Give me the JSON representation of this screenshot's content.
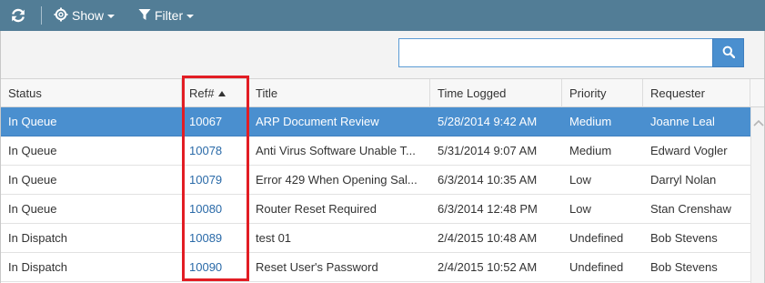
{
  "toolbar": {
    "show_label": "Show",
    "filter_label": "Filter"
  },
  "search": {
    "placeholder": "",
    "value": ""
  },
  "columns": {
    "status": "Status",
    "ref": "Ref#",
    "title": "Title",
    "time_logged": "Time Logged",
    "priority": "Priority",
    "requester": "Requester"
  },
  "sort": {
    "column": "ref",
    "direction": "ascending"
  },
  "rows": [
    {
      "status": "In Queue",
      "ref": "10067",
      "title": "ARP Document Review",
      "time_logged": "5/28/2014 9:42 AM",
      "priority": "Medium",
      "requester": "Joanne Leal",
      "selected": true
    },
    {
      "status": "In Queue",
      "ref": "10078",
      "title": "Anti Virus Software Unable T...",
      "time_logged": "5/31/2014 9:07 AM",
      "priority": "Medium",
      "requester": "Edward Vogler",
      "selected": false
    },
    {
      "status": "In Queue",
      "ref": "10079",
      "title": "Error 429 When Opening Sal...",
      "time_logged": "6/3/2014 10:35 AM",
      "priority": "Low",
      "requester": "Darryl Nolan",
      "selected": false
    },
    {
      "status": "In Queue",
      "ref": "10080",
      "title": "Router Reset Required",
      "time_logged": "6/3/2014 12:48 PM",
      "priority": "Low",
      "requester": "Stan Crenshaw",
      "selected": false
    },
    {
      "status": "In Dispatch",
      "ref": "10089",
      "title": "test 01",
      "time_logged": "2/4/2015 10:48 AM",
      "priority": "Undefined",
      "requester": "Bob Stevens",
      "selected": false
    },
    {
      "status": "In Dispatch",
      "ref": "10090",
      "title": "Reset User's Password",
      "time_logged": "2/4/2015 10:52 AM",
      "priority": "Undefined",
      "requester": "Bob Stevens",
      "selected": false
    }
  ],
  "colors": {
    "toolbar_bg": "#527d96",
    "selected_row": "#4a8fcf",
    "ref_link": "#2a6aa8",
    "highlight_box": "#e21d24"
  },
  "icons": {
    "refresh": "refresh-icon",
    "show": "gear-icon",
    "filter": "filter-icon",
    "search": "search-icon"
  }
}
